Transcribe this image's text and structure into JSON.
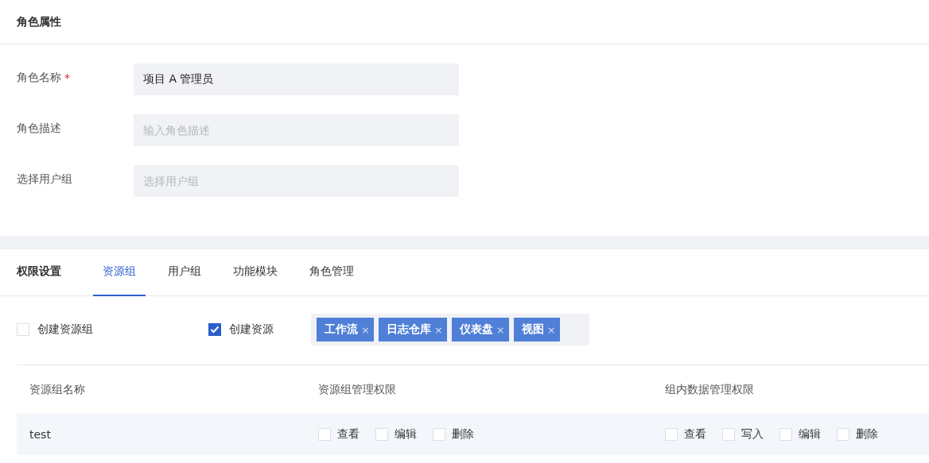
{
  "role_section": {
    "title": "角色属性"
  },
  "form": [
    {
      "label": "角色名称",
      "required_mark": "*",
      "value": "项目 A 管理员"
    },
    {
      "label": "角色描述",
      "placeholder": "输入角色描述"
    },
    {
      "label": "选择用户组",
      "placeholder": "选择用户组"
    }
  ],
  "permissions": {
    "title": "权限设置",
    "tabs": [
      {
        "label": "资源组",
        "selected": true
      },
      {
        "label": "用户组",
        "selected": false
      },
      {
        "label": "功能模块",
        "selected": false
      },
      {
        "label": "角色管理",
        "selected": false
      }
    ],
    "options": [
      {
        "label": "创建资源组",
        "checked": false
      },
      {
        "label": "创建资源",
        "checked": true
      }
    ],
    "tags": [
      {
        "label": "工作流",
        "remove": "×"
      },
      {
        "label": "日志仓库",
        "remove": "×"
      },
      {
        "label": "仪表盘",
        "remove": "×"
      },
      {
        "label": "视图",
        "remove": "×"
      }
    ],
    "table": {
      "columns": [
        "资源组名称",
        "资源组管理权限",
        "组内数据管理权限"
      ],
      "rows": [
        {
          "name": "test",
          "group_perms": [
            {
              "label": "查看",
              "checked": false
            },
            {
              "label": "编辑",
              "checked": false
            },
            {
              "label": "删除",
              "checked": false
            }
          ],
          "data_perms": [
            {
              "label": "查看",
              "checked": false
            },
            {
              "label": "写入",
              "checked": false
            },
            {
              "label": "编辑",
              "checked": false
            },
            {
              "label": "删除",
              "checked": false
            }
          ]
        }
      ]
    }
  }
}
